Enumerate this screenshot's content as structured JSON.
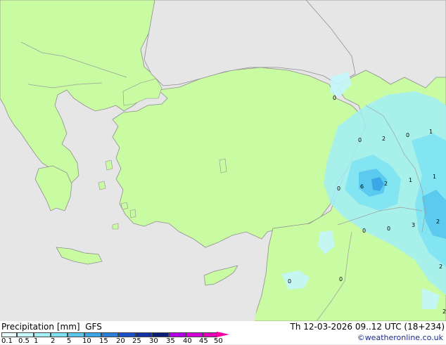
{
  "title": "Precipitation [mm]",
  "model": "GFS",
  "valid_time": "Th 12-03-2026 09..12 UTC (18+234)",
  "credit": "©weatheronline.co.uk",
  "colors": {
    "sea": "#e6e6e6",
    "land": "#c8fba2",
    "coast": "#8f8f8f",
    "border": "#9aa0a0"
  },
  "legend": {
    "ticks": [
      "0.1",
      "0.5",
      "1",
      "2",
      "5",
      "10",
      "15",
      "20",
      "25",
      "30",
      "35",
      "40",
      "45",
      "50"
    ],
    "colors": [
      "#e6fcff",
      "#c4f6fb",
      "#a2eff8",
      "#7ee2f3",
      "#5ac8ee",
      "#3aa8e6",
      "#2a7fdb",
      "#1a50c8",
      "#1232a2",
      "#0a1e78",
      "#b400e6",
      "#d400d8",
      "#e600bc",
      "#f000a0"
    ]
  },
  "point_values": [
    {
      "v": "0"
    },
    {
      "v": "0"
    },
    {
      "v": "2"
    },
    {
      "v": "0"
    },
    {
      "v": "1"
    },
    {
      "v": "0"
    },
    {
      "v": "6"
    },
    {
      "v": "2"
    },
    {
      "v": "1"
    },
    {
      "v": "1"
    },
    {
      "v": "0"
    },
    {
      "v": "0"
    },
    {
      "v": "3"
    },
    {
      "v": "2"
    },
    {
      "v": "2"
    },
    {
      "v": "0"
    },
    {
      "v": "0"
    },
    {
      "v": "2"
    }
  ]
}
